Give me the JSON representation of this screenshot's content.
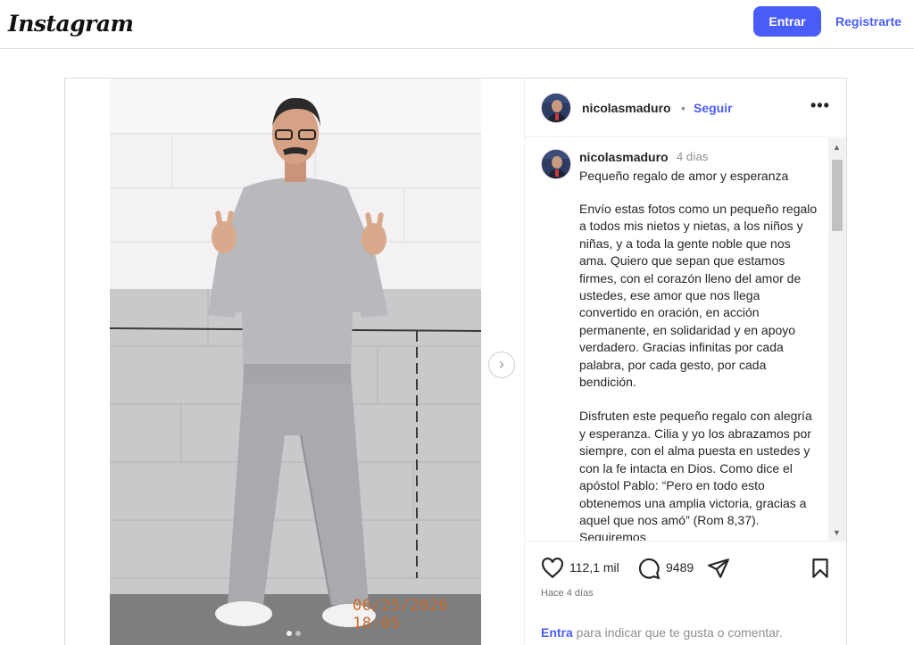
{
  "topbar": {
    "logo": "Instagram",
    "login_button": "Entrar",
    "register_link": "Registrarte"
  },
  "post": {
    "photo": {
      "timestamp_stamp": "06/25/2026 18:05",
      "carousel_dots": 2,
      "active_dot": 1
    },
    "header": {
      "username": "nicolasmaduro",
      "separator": "•",
      "follow": "Seguir"
    },
    "caption": {
      "username": "nicolasmaduro",
      "time": "4 días",
      "title": "Pequeño regalo de amor y esperanza",
      "paragraph1": "Envío estas fotos como un pequeño regalo a todos mis nietos y nietas, a los niños y niñas, y a toda la gente noble que nos ama. Quiero que sepan que estamos firmes, con el corazón lleno del amor de ustedes, ese amor que nos llega convertido en oración, en acción permanente, en solidaridad y en apoyo verdadero. Gracias infinitas por cada palabra, por cada gesto, por cada bendición.",
      "paragraph2": "Disfruten este pequeño regalo con alegría y esperanza. Cilia y yo los abrazamos por siempre, con el alma puesta en ustedes y con la fe intacta en Dios. Como dice el apóstol Pablo: “Pero en todo esto obtenemos una amplia victoria, gracias a aquel que nos amó” (Rom 8,37). Seguiremos"
    },
    "stats": {
      "likes": "112,1 mil",
      "comments": "9489"
    },
    "time_ago": "Hace 4 días",
    "login_prompt": {
      "link": "Entra",
      "rest": " para indicar que te gusta o comentar."
    }
  },
  "colors": {
    "accent": "#4a5df9",
    "border": "#dbdbdb",
    "muted": "#8e8e8e"
  }
}
